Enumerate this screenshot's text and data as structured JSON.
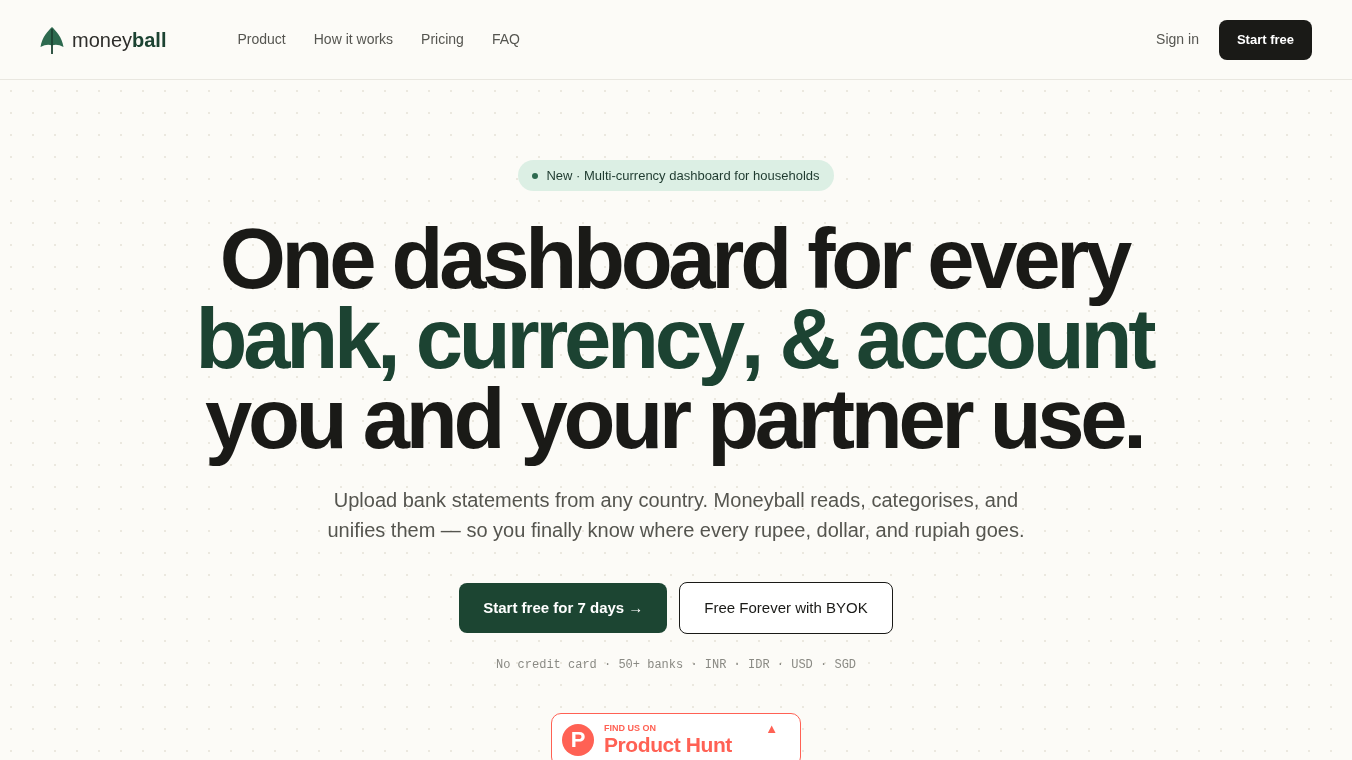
{
  "nav": {
    "logo": "money**ball**",
    "links": [
      "Product",
      "How it works",
      "Pricing",
      "FAQ"
    ],
    "sign_in": "Sign in",
    "cta": "Start free"
  },
  "hero": {
    "announcement": "New · Multi-currency dashboard for households",
    "headline": [
      {
        "text": "One dashboard for every",
        "accent": false
      },
      {
        "text": "bank, currency, & account",
        "accent": true
      },
      {
        "text": "you and your partner use.",
        "accent": false
      }
    ],
    "subtitle": "Upload bank statements from any country. Moneyball reads, categorises, and unifies them — so you finally know where every rupee, dollar, and rupiah goes.",
    "buttons": [
      {
        "label": "Start free for 7 days →",
        "kind": "primary"
      },
      {
        "label": "Free Forever with BYOK",
        "kind": "secondary"
      }
    ],
    "footnote": "No credit card · 50+ banks · INR · IDR · USD · SGD"
  },
  "product_hunt_badge": {
    "logo_letter": "P",
    "eyebrow": "FIND US ON",
    "name": "Product Hunt",
    "arrow": "▲"
  }
}
